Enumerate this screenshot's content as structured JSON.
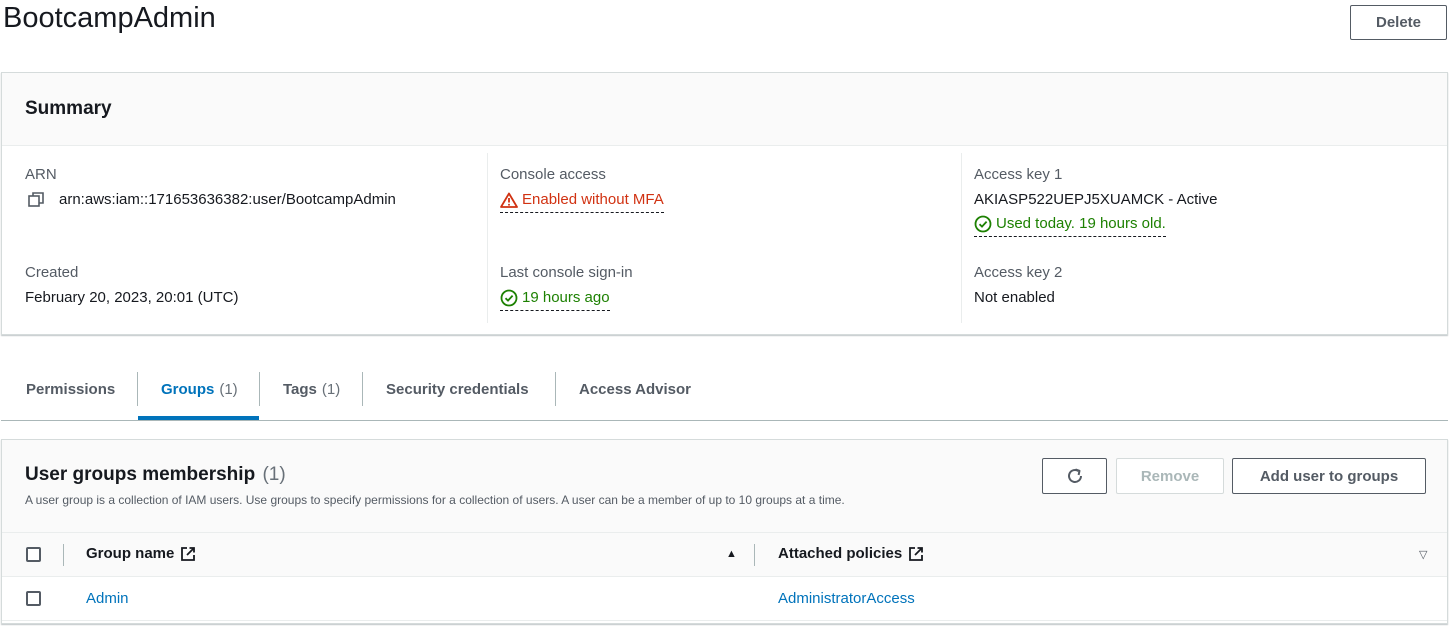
{
  "page": {
    "title": "BootcampAdmin",
    "delete_label": "Delete"
  },
  "summary": {
    "title": "Summary",
    "arn_label": "ARN",
    "arn_value": "arn:aws:iam::171653636382:user/BootcampAdmin",
    "created_label": "Created",
    "created_value": "February 20, 2023, 20:01 (UTC)",
    "console_access_label": "Console access",
    "console_access_value": "Enabled without MFA",
    "last_signin_label": "Last console sign-in",
    "last_signin_value": "19 hours ago",
    "access_key1_label": "Access key 1",
    "access_key1_value": "AKIASP522UEPJ5XUAMCK - Active",
    "access_key1_status": "Used today. 19 hours old.",
    "access_key2_label": "Access key 2",
    "access_key2_value": "Not enabled"
  },
  "tabs": [
    {
      "label": "Permissions",
      "count": ""
    },
    {
      "label": "Groups",
      "count": "(1)"
    },
    {
      "label": "Tags",
      "count": "(1)"
    },
    {
      "label": "Security credentials",
      "count": ""
    },
    {
      "label": "Access Advisor",
      "count": ""
    }
  ],
  "active_tab": "Groups",
  "groups_panel": {
    "title": "User groups membership",
    "count": "(1)",
    "description": "A user group is a collection of IAM users. Use groups to specify permissions for a collection of users. A user can be a member of up to 10 groups at a time.",
    "remove_label": "Remove",
    "add_label": "Add user to groups",
    "columns": [
      "Group name",
      "Attached policies"
    ],
    "rows": [
      {
        "group_name": "Admin",
        "attached_policies": "AdministratorAccess"
      }
    ]
  },
  "colors": {
    "accent": "#0073bb",
    "warning": "#d13212",
    "success": "#1d8102"
  },
  "icons": {
    "copy": "copy-icon",
    "warning": "warning-triangle-icon",
    "success": "check-circle-icon",
    "refresh": "refresh-icon",
    "external": "external-link-icon",
    "sort_asc": "sort-ascending-icon",
    "sort_desc": "sort-descending-icon"
  }
}
